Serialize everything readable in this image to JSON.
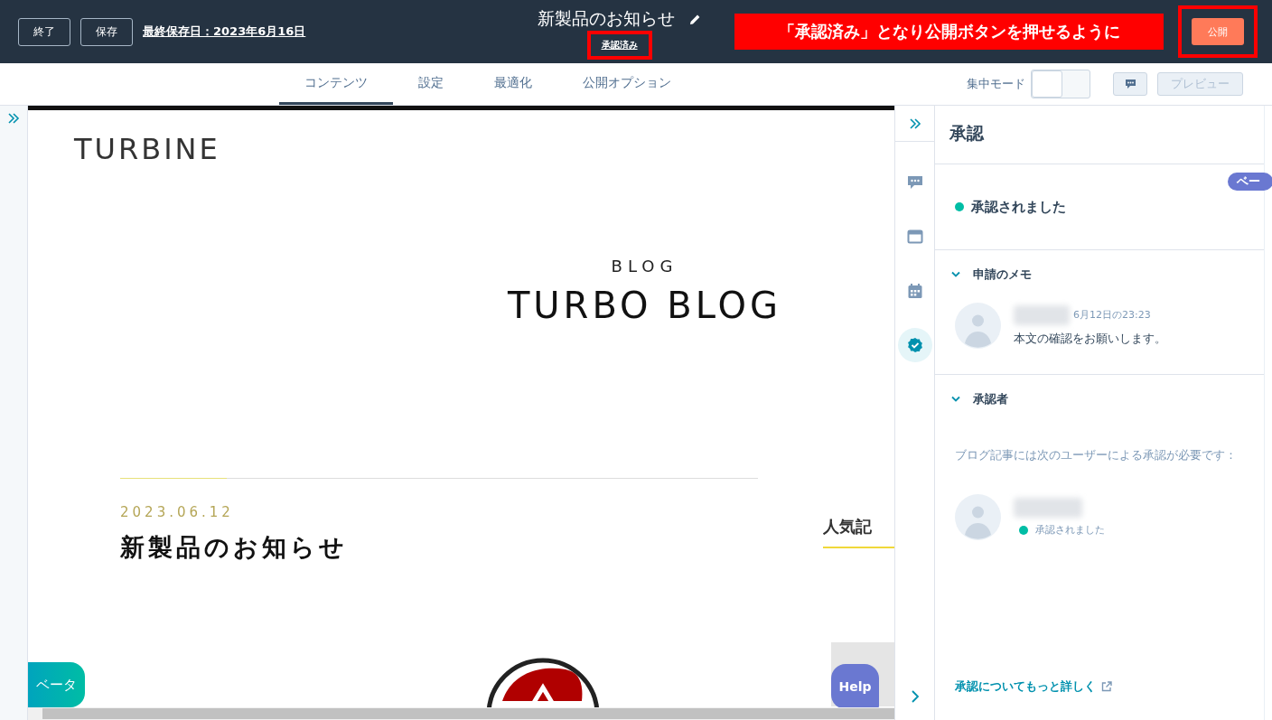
{
  "header": {
    "buttons": [
      "終了",
      "保存"
    ],
    "last_saved": "最終保存日：2023年6月16日",
    "title": "新製品のお知らせ",
    "status": {
      "label": "承認済み",
      "highlighted": true
    },
    "annotation": "「承認済み」となり公開ボタンを押せるように",
    "publish": {
      "label": "公開",
      "highlighted": true
    }
  },
  "tabs": [
    {
      "label": "コンテンツ",
      "selected": true
    },
    {
      "label": "設定",
      "selected": false
    },
    {
      "label": "最適化",
      "selected": false
    },
    {
      "label": "公開オプション",
      "selected": false
    }
  ],
  "focus_mode": {
    "label": "集中モード",
    "on": false
  },
  "preview_button": {
    "label": "プレビュー",
    "disabled": true
  },
  "preview": {
    "logo": "TURBINE",
    "blog_label": "BLOG",
    "blog_title": "TURBO BLOG",
    "date": "2023.06.12",
    "post_title": "新製品のお知らせ",
    "side_heading": "人気記",
    "beta_button": "ベータ",
    "help_button": "Help"
  },
  "rail": [
    {
      "kind": "comments",
      "selected": false
    },
    {
      "kind": "layout",
      "selected": false
    },
    {
      "kind": "calendar",
      "selected": false
    },
    {
      "kind": "approval",
      "selected": true
    }
  ],
  "panel": {
    "title": "承認",
    "badge": "ベー",
    "status": {
      "label": "承認されました",
      "color": "#00bda5"
    },
    "note_section": {
      "title": "申請のメモ",
      "expanded": true,
      "time": "6月12日の23:23",
      "text": "本文の確認をお願いします。"
    },
    "approver_section": {
      "title": "承認者",
      "expanded": true,
      "description": "ブログ記事には次のユーザーによる承認が必要です：",
      "approver_status": {
        "label": "承認されました",
        "color": "#00bda5"
      }
    },
    "link": "承認についてもっと詳しく"
  }
}
